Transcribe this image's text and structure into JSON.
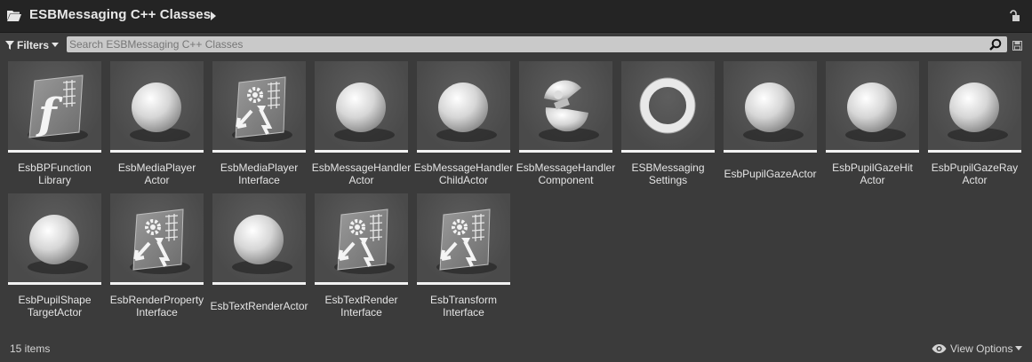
{
  "header": {
    "title": "ESBMessaging C++ Classes",
    "folder_icon": "folder-open-icon",
    "arrow_icon": "chevron-right-icon",
    "lock_icon": "lock-icon"
  },
  "toolbar": {
    "filters_label": "Filters",
    "search_placeholder": "Search ESBMessaging C++ Classes",
    "search_value": ""
  },
  "assets": [
    {
      "line1": "EsbBPFunction",
      "line2": "Library",
      "icon": "function-library-icon"
    },
    {
      "line1": "EsbMediaPlayer",
      "line2": "Actor",
      "icon": "sphere-actor-icon"
    },
    {
      "line1": "EsbMediaPlayer",
      "line2": "Interface",
      "icon": "interface-icon"
    },
    {
      "line1": "EsbMessageHandler",
      "line2": "Actor",
      "icon": "sphere-actor-icon"
    },
    {
      "line1": "EsbMessageHandler",
      "line2": "ChildActor",
      "icon": "sphere-actor-icon"
    },
    {
      "line1": "EsbMessageHandler",
      "line2": "Component",
      "icon": "component-icon"
    },
    {
      "line1": "ESBMessaging",
      "line2": "Settings",
      "icon": "settings-ring-icon"
    },
    {
      "line1": "EsbPupilGazeActor",
      "line2": "",
      "icon": "sphere-actor-icon"
    },
    {
      "line1": "EsbPupilGazeHit",
      "line2": "Actor",
      "icon": "sphere-actor-icon"
    },
    {
      "line1": "EsbPupilGazeRay",
      "line2": "Actor",
      "icon": "sphere-actor-icon"
    },
    {
      "line1": "EsbPupilShape",
      "line2": "TargetActor",
      "icon": "sphere-actor-icon"
    },
    {
      "line1": "EsbRenderProperty",
      "line2": "Interface",
      "icon": "interface-icon"
    },
    {
      "line1": "EsbTextRenderActor",
      "line2": "",
      "icon": "sphere-actor-icon"
    },
    {
      "line1": "EsbTextRender",
      "line2": "Interface",
      "icon": "interface-icon"
    },
    {
      "line1": "EsbTransform",
      "line2": "Interface",
      "icon": "interface-icon"
    }
  ],
  "footer": {
    "item_count": "15 items",
    "view_options_label": "View Options"
  }
}
